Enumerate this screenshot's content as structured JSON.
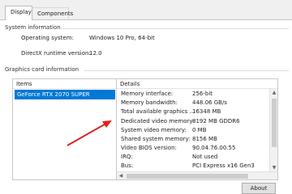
{
  "tabs": [
    {
      "label": "Display",
      "active": true
    },
    {
      "label": "Components",
      "active": false
    }
  ],
  "system_info": {
    "title": "System information",
    "rows": [
      {
        "label": "Operating system:",
        "value": "Windows 10 Pro, 64-bit"
      },
      {
        "label": "DirectX runtime version:",
        "value": "12.0"
      }
    ]
  },
  "graphics_info": {
    "title": "Graphics card information",
    "items_header": "Items",
    "details_header": "Details",
    "selected_item": "GeForce RTX 2070 SUPER",
    "details": [
      {
        "key": "Memory interface:",
        "value": "256-bit"
      },
      {
        "key": "Memory bandwidth:",
        "value": "448.06 GB/s"
      },
      {
        "key": "Total available graphics ...",
        "value": "16348 MB"
      },
      {
        "key": "Dedicated video memory:",
        "value": "8192 MB GDDR6"
      },
      {
        "key": "System video memory:",
        "value": "0 MB"
      },
      {
        "key": "Shared system memory:",
        "value": "8156 MB"
      },
      {
        "key": "Video BIOS version:",
        "value": "90.04.76.00.55"
      },
      {
        "key": "IRQ:",
        "value": "Not used"
      },
      {
        "key": "Bus:",
        "value": "PCI Express x16 Gen3"
      }
    ]
  },
  "buttons": {
    "about": "About"
  },
  "colors": {
    "selection": "#0078d7",
    "annotation_arrow": "#e02020"
  }
}
